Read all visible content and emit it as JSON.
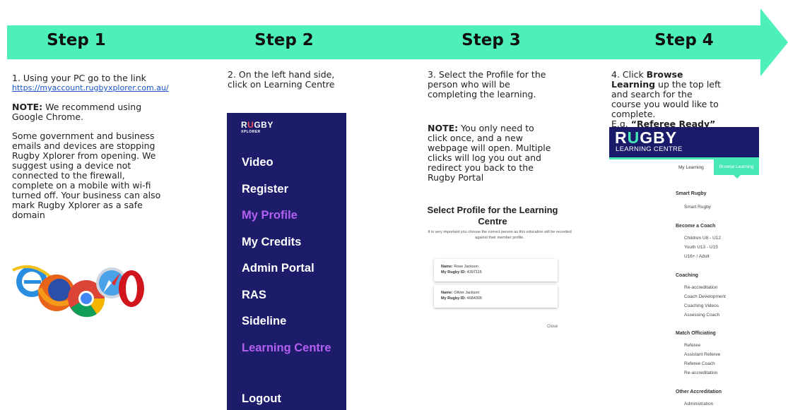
{
  "colors": {
    "arrow": "#4cf0b8",
    "panel_bg": "#1c1c6b",
    "active_nav": "#b360f0",
    "lc_header": "#1a1a6b",
    "lc_accent": "#47e8b5"
  },
  "steps": [
    {
      "title": "Step 1"
    },
    {
      "title": "Step 2"
    },
    {
      "title": "Step 3"
    },
    {
      "title": "Step 4"
    }
  ],
  "step1": {
    "intro": "1. Using your PC go to the link",
    "link": "https://myaccount.rugbyxplorer.com.au/",
    "note_label": "NOTE:",
    "note_text": " We recommend using Google Chrome.",
    "para": "Some government and business emails and devices are stopping Rugby Xplorer from opening. We suggest using a device not connected to the firewall, complete on a mobile with wi-fi turned off. Your business can also mark Rugby Xplorer as a safe domain",
    "browser_icons": [
      "internet-explorer-icon",
      "firefox-icon",
      "chrome-icon",
      "safari-icon",
      "opera-icon"
    ]
  },
  "step2": {
    "instruction": "2. On the left hand side, click on Learning Centre",
    "logo_big_r": "R",
    "logo_big_u": "U",
    "logo_big_rest": "GBY",
    "logo_small": "XPLORER",
    "nav": [
      "Video",
      "Register",
      "My Profile",
      "My Credits",
      "Admin Portal",
      "RAS",
      "Sideline",
      "Learning Centre",
      "Logout"
    ]
  },
  "step3": {
    "instruction": "3. Select the Profile for the person who will be completing the learning.",
    "note_label": "NOTE:",
    "note_text": " You only need to click once, and a new webpage will open. Multiple clicks will log you out and redirect you back to the Rugby Portal",
    "dialog_title": "Select Profile for the Learning Centre",
    "dialog_sub": "It is very important you choose the correct person as this education will be recorded against their member profile.",
    "profiles": [
      {
        "name_label": "Name:",
        "name": " Rose Jackson",
        "id_label": "My Rugby ID:",
        "id": " 4397115"
      },
      {
        "name_label": "Name:",
        "name": " Oliver Jackson",
        "id_label": "My Rugby ID:",
        "id": " 4684305"
      }
    ],
    "close": "Close"
  },
  "step4": {
    "instruction_pre": "4. Click ",
    "instruction_bold": "Browse Learning",
    "instruction_post": " up the top left and search for the course you would like to complete.",
    "example_pre": "E.g. ",
    "example_bold": "“Referee Ready”",
    "logo_r": "R",
    "logo_u": "U",
    "logo_rest": "GBY",
    "logo_sub": "LEARNING CENTRE",
    "tab_my": "My Learning",
    "tab_browse": "Browse Learning",
    "categories": [
      {
        "title": "Smart Rugby",
        "items": [
          "Smart Rugby"
        ]
      },
      {
        "title": "Become a Coach",
        "items": [
          "Children U8 - U12",
          "Youth U13 - U15",
          "U16+ / Adult"
        ]
      },
      {
        "title": "Coaching",
        "items": [
          "Re-accreditation",
          "Coach Development",
          "Coaching Videos",
          "Assessing Coach"
        ]
      },
      {
        "title": "Match Officiating",
        "items": [
          "Referee",
          "Assistant Referee",
          "Referee Coach",
          "Re-accreditation"
        ]
      },
      {
        "title": "Other Accreditation",
        "items": [
          "Administration"
        ]
      }
    ]
  }
}
